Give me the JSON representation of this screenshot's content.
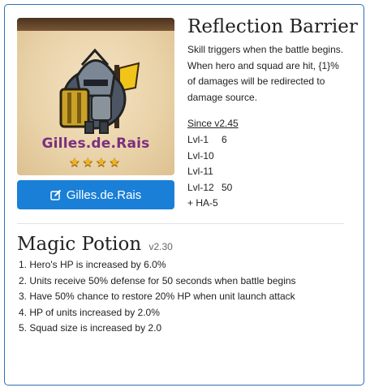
{
  "hero": {
    "name": "Gilles.de.Rais",
    "stars": "★★★★",
    "button_label": "Gilles.de.Rais"
  },
  "skill": {
    "title": "Reflection Barrier",
    "description": "Skill triggers when the battle begins. When hero and squad are hit, {1}% of damages will be redirected to damage source.",
    "since": "Since v2.45",
    "levels": [
      {
        "level": "Lvl-1",
        "value": "6"
      },
      {
        "level": "Lvl-10",
        "value": ""
      },
      {
        "level": "Lvl-11",
        "value": ""
      },
      {
        "level": "Lvl-12",
        "value": "50"
      },
      {
        "level": "+ HA-5",
        "value": ""
      }
    ]
  },
  "potion": {
    "title": "Magic Potion",
    "version": "v2.30",
    "effects": [
      "1. Hero's HP is increased by 6.0%",
      "2. Units receive 50% defense for 50 seconds when battle begins",
      "3. Have 50% chance to restore 20% HP when unit launch attack",
      "4. HP of units increased by 2.0%",
      "5. Squad size is increased by 2.0"
    ]
  },
  "colors": {
    "border": "#2d6fb5",
    "button": "#1a7fd6",
    "hero_name": "#7a2f7f",
    "stars": "#f3b51a"
  },
  "icons": {
    "button_icon": "edit-icon"
  }
}
